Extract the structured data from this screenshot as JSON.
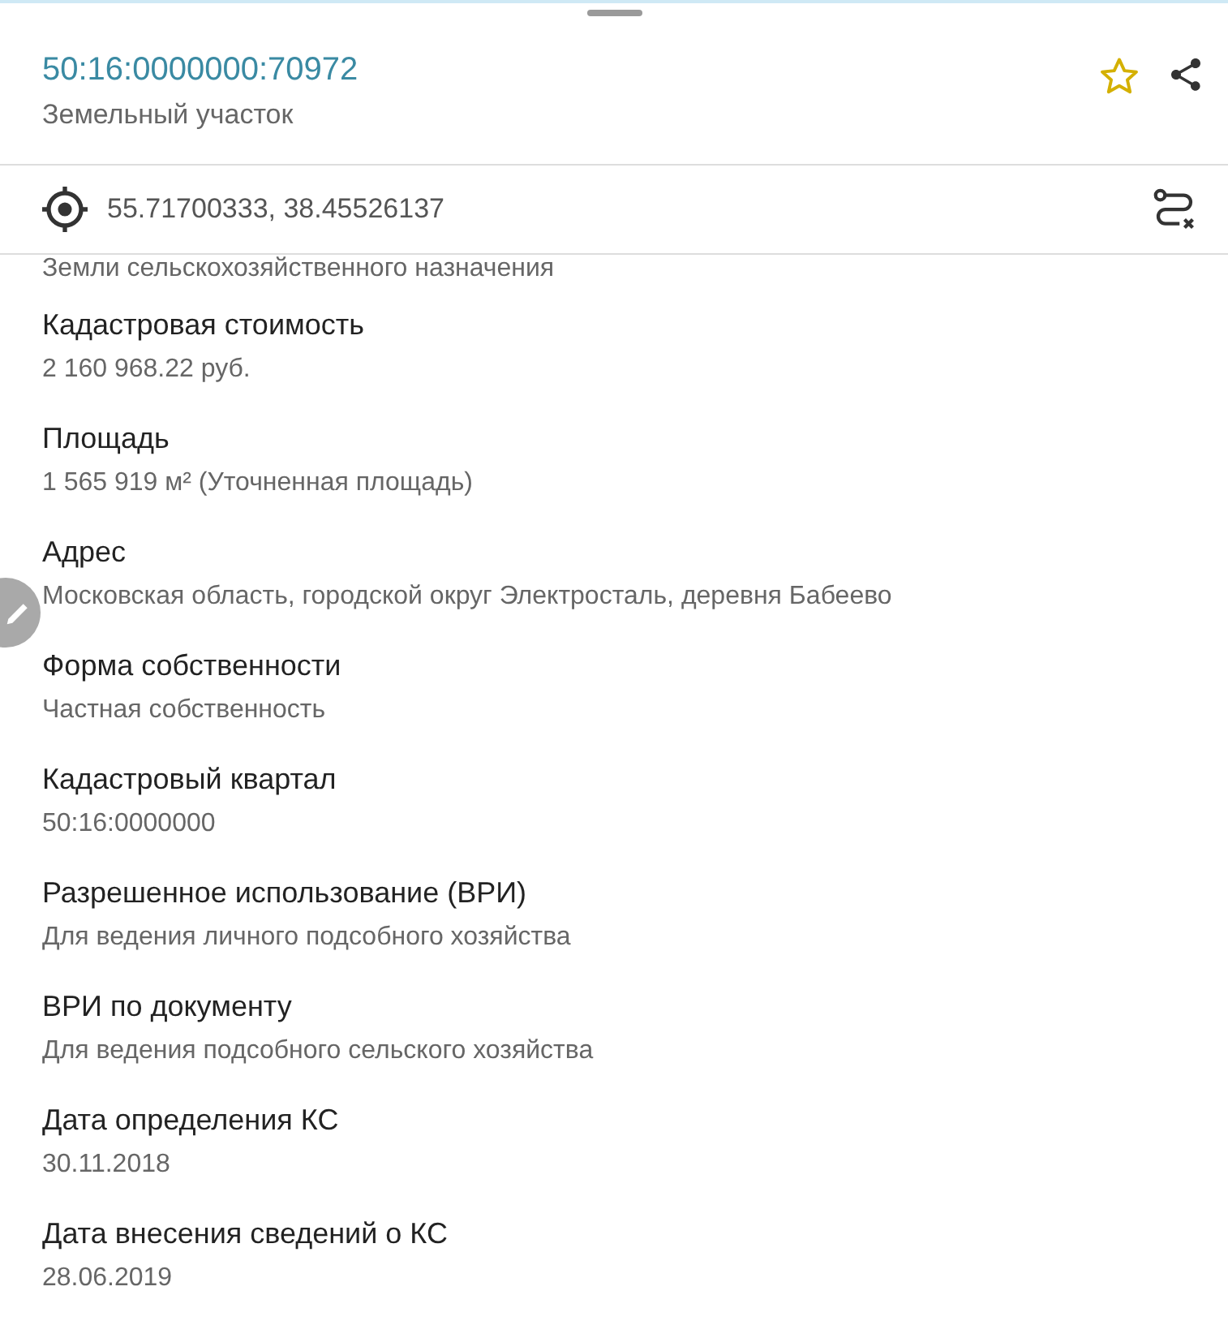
{
  "header": {
    "title": "50:16:0000000:70972",
    "subtitle": "Земельный участок"
  },
  "coordinates": "55.71700333, 38.45526137",
  "partial_line": "Земли сельскохозяйственного назначения",
  "fields": [
    {
      "label": "Кадастровая стоимость",
      "value": "2 160 968.22 руб."
    },
    {
      "label": "Площадь",
      "value": "1 565 919 м² (Уточненная площадь)"
    },
    {
      "label": "Адрес",
      "value": "Московская область, городской округ Электросталь, деревня Бабеево"
    },
    {
      "label": "Форма собственности",
      "value": "Частная собственность"
    },
    {
      "label": "Кадастровый квартал",
      "value": "50:16:0000000"
    },
    {
      "label": "Разрешенное использование (ВРИ)",
      "value": "Для ведения личного подсобного хозяйства"
    },
    {
      "label": "ВРИ по документу",
      "value": "Для ведения подсобного сельского хозяйства"
    },
    {
      "label": "Дата определения КС",
      "value": "30.11.2018"
    },
    {
      "label": "Дата внесения сведений о КС",
      "value": "28.06.2019"
    }
  ]
}
